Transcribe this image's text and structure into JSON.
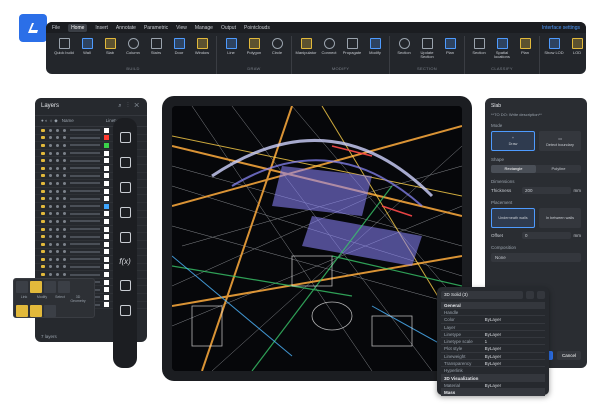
{
  "menu": {
    "items": [
      "File",
      "Home",
      "Insert",
      "Annotate",
      "Parametric",
      "View",
      "Manage",
      "Output",
      "Pointclouds"
    ],
    "active": "Home",
    "interface_settings": "Interface settings"
  },
  "ribbon": {
    "groups": [
      {
        "name": "BUILD",
        "tools": [
          "Quick build",
          "Wall",
          "Slab",
          "Column",
          "Stairs",
          "Door",
          "Window"
        ]
      },
      {
        "name": "DRAW",
        "tools": [
          "Line",
          "Polygon",
          "Circle"
        ]
      },
      {
        "name": "MODIFY",
        "tools": [
          "Manipulator",
          "Connect",
          "Propagate",
          "Modify"
        ]
      },
      {
        "name": "SECTION",
        "tools": [
          "Section",
          "Update Section",
          "Plan"
        ]
      },
      {
        "name": "CLASSIFY",
        "tools": [
          "Section",
          "Spatial locations",
          "Plan"
        ]
      },
      {
        "name": "VIEW",
        "tools": [
          "Show LOD",
          "LOD",
          "Render Composition",
          "Features",
          "Graphic Overrides"
        ]
      },
      {
        "name": "SELECT",
        "tools": [
          "Select"
        ]
      }
    ]
  },
  "layers": {
    "title": "Layers",
    "headers": [
      "Name",
      "Linetype",
      "Lin"
    ],
    "footer": "7 layers",
    "swatch_colors": [
      "#ffffff",
      "#ff3b30",
      "#3ad24a",
      "#ffffff",
      "#ffffff",
      "#ffffff",
      "#ffffff",
      "#ffffff",
      "#ffffff",
      "#ffffff",
      "#3fa7ff",
      "#ffffff",
      "#ffffff",
      "#ffffff",
      "#ffffff",
      "#ffffff",
      "#ffffff",
      "#ffffff",
      "#ffffff",
      "#ffffff",
      "#ffffff",
      "#ffffff",
      "#ffffff",
      "#ffffff"
    ]
  },
  "popup": {
    "labels": [
      "Link",
      "Modify",
      "Select",
      "3D Geometry"
    ]
  },
  "right_panel": {
    "title": "Slab",
    "description": "**TO DO: Write description**",
    "mode_label": "Mode",
    "mode_draw": "Draw",
    "mode_boundary": "Detect boundary",
    "shape_label": "Shape",
    "shape_options": [
      "Rectangle",
      "Polyline"
    ],
    "dimensions_label": "Dimensions",
    "thickness_label": "Thickness",
    "thickness_value": "200",
    "unit": "mm",
    "placement_label": "Placement",
    "placement_a": "Underneath walls",
    "placement_b": "In between walls",
    "offset_label": "Offset",
    "offset_value": "0",
    "composition_label": "Composition",
    "composition_value": "None",
    "ok": "OK",
    "cancel": "Cancel"
  },
  "properties": {
    "selection": "3D Solid (3)",
    "general": "General",
    "rows": [
      {
        "k": "Handle",
        "v": ""
      },
      {
        "k": "Color",
        "v": "ByLayer"
      },
      {
        "k": "Layer",
        "v": ""
      },
      {
        "k": "Linetype",
        "v": "ByLayer"
      },
      {
        "k": "Linetype scale",
        "v": "1"
      },
      {
        "k": "Plot style",
        "v": "ByLayer"
      },
      {
        "k": "Lineweight",
        "v": "ByLayer"
      },
      {
        "k": "Transparency",
        "v": "ByLayer"
      },
      {
        "k": "Hyperlink",
        "v": ""
      }
    ],
    "viz": "3D Visualization",
    "material_k": "Material",
    "material_v": "ByLayer",
    "mass": "Mass"
  }
}
